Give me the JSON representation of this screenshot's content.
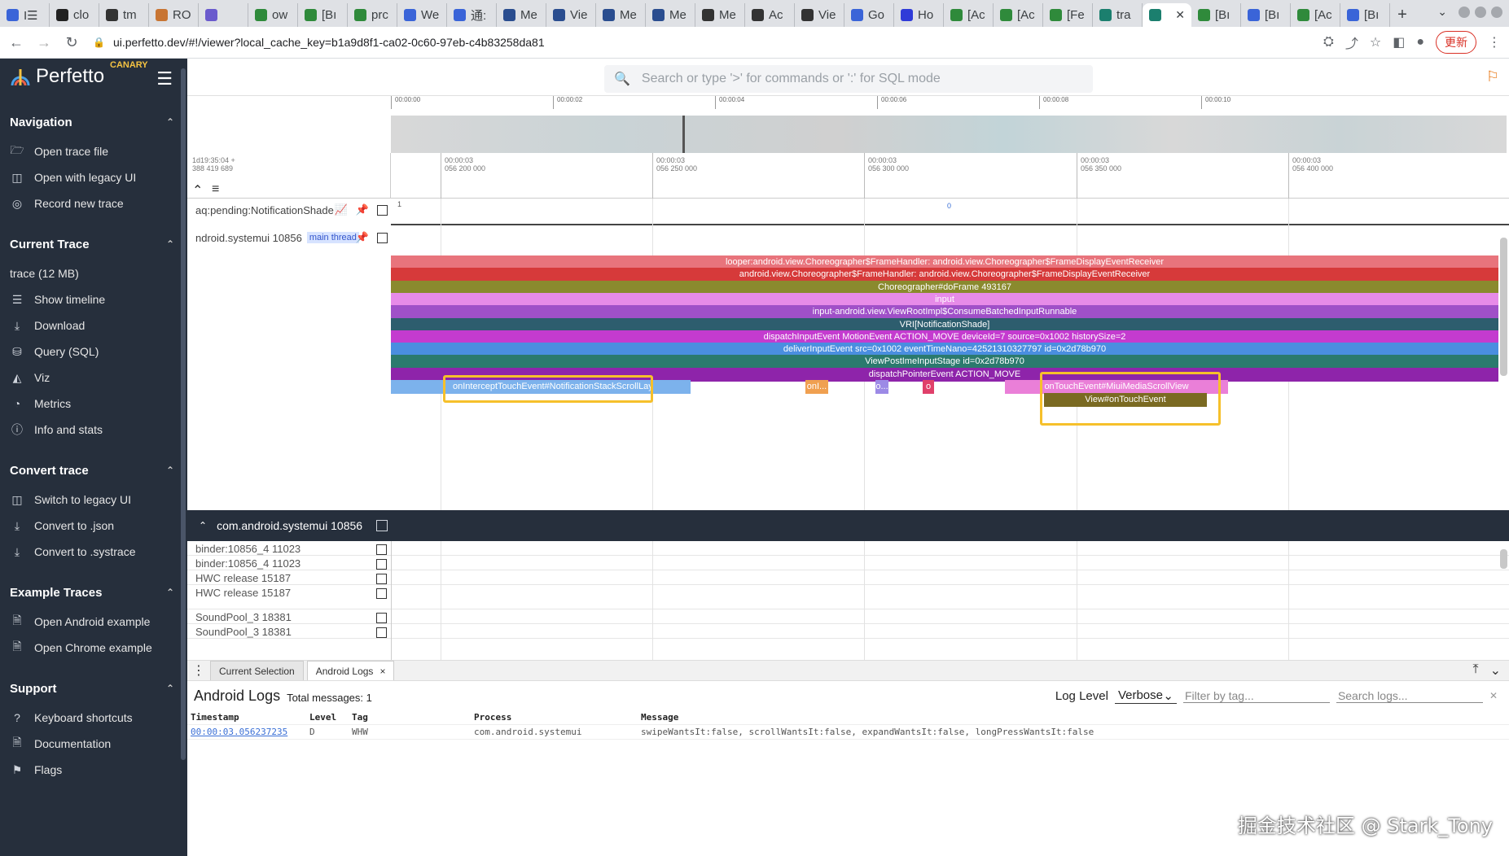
{
  "browser": {
    "tabs": [
      {
        "label": "I☰",
        "color": "#3a64d8"
      },
      {
        "label": "clo",
        "color": "#222"
      },
      {
        "label": "tm",
        "color": "#333"
      },
      {
        "label": "RO",
        "color": "#c87533"
      },
      {
        "label": "",
        "color": "#6a5acd"
      },
      {
        "label": "ow",
        "color": "#2f8a3b"
      },
      {
        "label": "[Bı",
        "color": "#2f8a3b"
      },
      {
        "label": "prc",
        "color": "#2f8a3b"
      },
      {
        "label": "We",
        "color": "#3a64d8"
      },
      {
        "label": "通:",
        "color": "#3a64d8"
      },
      {
        "label": "Me",
        "color": "#2a4d8f"
      },
      {
        "label": "Vie",
        "color": "#2a4d8f"
      },
      {
        "label": "Me",
        "color": "#2a4d8f"
      },
      {
        "label": "Me",
        "color": "#2a4d8f"
      },
      {
        "label": "Me",
        "color": "#333"
      },
      {
        "label": "Ac",
        "color": "#333"
      },
      {
        "label": "Vie",
        "color": "#333"
      },
      {
        "label": "Go",
        "color": "#3a64d8"
      },
      {
        "label": "Ho",
        "color": "#2f3bd8"
      },
      {
        "label": "[Ac",
        "color": "#2f8a3b"
      },
      {
        "label": "[Ac",
        "color": "#2f8a3b"
      },
      {
        "label": "[Fe",
        "color": "#2f8a3b"
      },
      {
        "label": "tra",
        "color": "#1b7f6e"
      },
      {
        "label": "",
        "color": "#1b7f6e",
        "active": true
      },
      {
        "label": "[Bı",
        "color": "#2f8a3b"
      },
      {
        "label": "[Bı",
        "color": "#3a64d8"
      },
      {
        "label": "[Ac",
        "color": "#2f8a3b"
      },
      {
        "label": "[Bı",
        "color": "#3a64d8"
      }
    ],
    "url": "ui.perfetto.dev/#!/viewer?local_cache_key=b1a9d8f1-ca02-0c60-97eb-c4b83258da81",
    "update_label": "更新"
  },
  "sidebar": {
    "logo": "Perfetto",
    "channel": "CANARY",
    "sections": [
      {
        "title": "Navigation",
        "items": [
          {
            "icon": "folder-open-icon",
            "glyph": "🗁",
            "label": "Open trace file"
          },
          {
            "icon": "legacy-ui-icon",
            "glyph": "◫",
            "label": "Open with legacy UI"
          },
          {
            "icon": "record-icon",
            "glyph": "◎",
            "label": "Record new trace"
          }
        ]
      },
      {
        "title": "Current Trace",
        "subtitle": "trace (12 MB)",
        "items": [
          {
            "icon": "timeline-icon",
            "glyph": "☰",
            "label": "Show timeline"
          },
          {
            "icon": "download-icon",
            "glyph": "⤓",
            "label": "Download"
          },
          {
            "icon": "database-icon",
            "glyph": "⛁",
            "label": "Query (SQL)"
          },
          {
            "icon": "viz-icon",
            "glyph": "◭",
            "label": "Viz"
          },
          {
            "icon": "metrics-icon",
            "glyph": "◔",
            "label": "Metrics"
          },
          {
            "icon": "info-icon",
            "glyph": "ⓘ",
            "label": "Info and stats"
          }
        ]
      },
      {
        "title": "Convert trace",
        "items": [
          {
            "icon": "legacy-ui-icon",
            "glyph": "◫",
            "label": "Switch to legacy UI"
          },
          {
            "icon": "download-icon",
            "glyph": "⤓",
            "label": "Convert to .json"
          },
          {
            "icon": "download-icon",
            "glyph": "⤓",
            "label": "Convert to .systrace"
          }
        ]
      },
      {
        "title": "Example Traces",
        "items": [
          {
            "icon": "file-icon",
            "glyph": "🗎",
            "label": "Open Android example"
          },
          {
            "icon": "file-icon",
            "glyph": "🗎",
            "label": "Open Chrome example"
          }
        ]
      },
      {
        "title": "Support",
        "items": [
          {
            "icon": "help-icon",
            "glyph": "?",
            "label": "Keyboard shortcuts"
          },
          {
            "icon": "docs-icon",
            "glyph": "🗎",
            "label": "Documentation"
          },
          {
            "icon": "flags-icon",
            "glyph": "⚑",
            "label": "Flags"
          }
        ]
      }
    ]
  },
  "omnibox": {
    "placeholder": "Search or type '>' for commands or ':' for SQL mode"
  },
  "overview": {
    "ticks": [
      "00:00:00",
      "00:00:02",
      "00:00:04",
      "00:00:06",
      "00:00:08",
      "00:00:10"
    ]
  },
  "ruler": {
    "offset_line1": "1d19:35:04 +",
    "offset_line2": "388 419 689",
    "ticks": [
      {
        "l1": "00:00:03",
        "l2": "056 200 000"
      },
      {
        "l1": "00:00:03",
        "l2": "056 250 000"
      },
      {
        "l1": "00:00:03",
        "l2": "056 300 000"
      },
      {
        "l1": "00:00:03",
        "l2": "056 350 000"
      },
      {
        "l1": "00:00:03",
        "l2": "056 400 000"
      }
    ]
  },
  "tracks": {
    "counter": {
      "name": "aq:pending:NotificationShade",
      "value_left": "1",
      "value_mid": "0"
    },
    "thread": {
      "name": "ndroid.systemui 10856",
      "chip": "main thread"
    },
    "slices": [
      {
        "label": "looper:android.view.Choreographer$FrameHandler: android.view.Choreographer$FrameDisplayEventReceiver",
        "color": "#e8747c"
      },
      {
        "label": "android.view.Choreographer$FrameHandler: android.view.Choreographer$FrameDisplayEventReceiver",
        "color": "#d63a3a"
      },
      {
        "label": "Choreographer#doFrame 493167",
        "color": "#8a8a2e"
      },
      {
        "label": "input",
        "color": "#e78be8"
      },
      {
        "label": "input-android.view.ViewRootImpl$ConsumeBatchedInputRunnable",
        "color": "#a050c8"
      },
      {
        "label": "VRI[NotificationShade]",
        "color": "#2d5d6e"
      },
      {
        "label": "dispatchInputEvent MotionEvent ACTION_MOVE deviceId=7 source=0x1002 historySize=2",
        "color": "#c43bcf"
      },
      {
        "label": "deliverInputEvent src=0x1002 eventTimeNano=42521310327797 id=0x2d78b970",
        "color": "#4a8ee0"
      },
      {
        "label": "ViewPostImeInputStage id=0x2d78b970",
        "color": "#2b7a6e"
      },
      {
        "label": "dispatchPointerEvent ACTION_MOVE",
        "color": "#8e24aa"
      }
    ],
    "depth10": [
      {
        "label": "",
        "color": "#7cb2ec"
      },
      {
        "label": "onInterceptTouchEvent#NotificationStackScrollLayout",
        "color": "#7cb2ec"
      },
      {
        "label": "onI...",
        "color": "#f0a050"
      },
      {
        "label": "o...",
        "color": "#9c8ae6"
      },
      {
        "label": "o",
        "color": "#e0406a"
      },
      {
        "label": "onTouchEvent#MiuiMediaScrollView",
        "color": "#ea7fd8"
      }
    ],
    "depth11": [
      {
        "label": "View#onTouchEvent",
        "color": "#7a6a22"
      }
    ]
  },
  "process": {
    "name": "com.android.systemui 10856",
    "threads": [
      "binder:10856_4 11023",
      "binder:10856_4 11023",
      "HWC release 15187",
      "HWC release 15187",
      "SoundPool_3 18381",
      "SoundPool_3 18381"
    ]
  },
  "details": {
    "tabs": [
      "Current Selection",
      "Android Logs"
    ],
    "logs": {
      "title": "Android Logs",
      "total": "Total messages: 1",
      "level_label": "Log Level",
      "level_value": "Verbose",
      "filter_placeholder": "Filter by tag...",
      "search_placeholder": "Search logs...",
      "headers": [
        "Timestamp",
        "Level",
        "Tag",
        "Process",
        "Message"
      ],
      "rows": [
        {
          "ts": "00:00:03.056237235",
          "level": "D",
          "tag": "WHW",
          "process": "com.android.systemui",
          "message": "swipeWantsIt:false, scrollWantsIt:false, expandWantsIt:false, longPressWantsIt:false"
        }
      ]
    }
  },
  "watermark": "掘金技术社区 @ Stark_Tony"
}
